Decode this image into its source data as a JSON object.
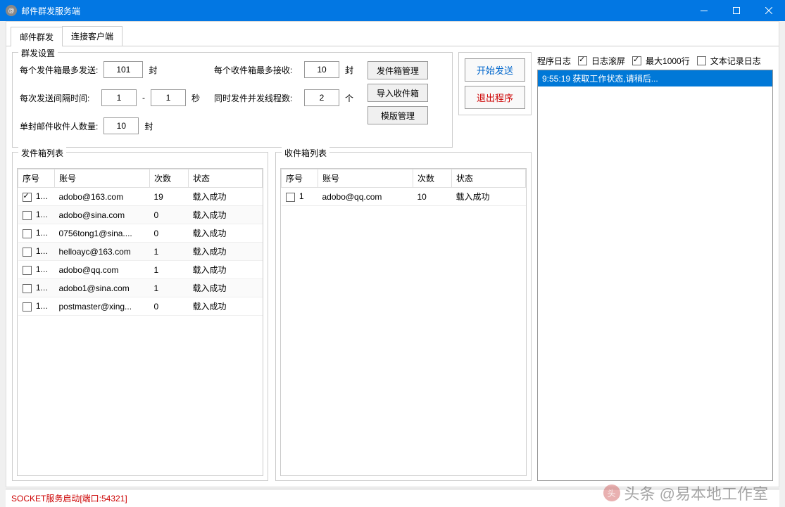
{
  "window": {
    "title": "邮件群发服务端"
  },
  "tabs": {
    "mass_mail": "邮件群发",
    "connect_client": "连接客户端"
  },
  "settings": {
    "legend": "群发设置",
    "max_send_per_sender_label": "每个发件箱最多发送:",
    "max_send_per_sender_value": "101",
    "max_send_unit": "封",
    "interval_label": "每次发送间隔时间:",
    "interval_from": "1",
    "interval_to": "1",
    "interval_sep": "-",
    "interval_unit": "秒",
    "recipients_per_mail_label": "单封邮件收件人数量:",
    "recipients_per_mail_value": "10",
    "recipients_per_mail_unit": "封",
    "max_recv_per_recipient_label": "每个收件箱最多接收:",
    "max_recv_per_recipient_value": "10",
    "max_recv_unit": "封",
    "concurrent_threads_label": "同时发件并发线程数:",
    "concurrent_threads_value": "2",
    "concurrent_unit": "个",
    "btn_sender_mgmt": "发件箱管理",
    "btn_import_recipient": "导入收件箱",
    "btn_template_mgmt": "模版管理"
  },
  "actions": {
    "start_send": "开始发送",
    "exit_program": "退出程序"
  },
  "sender_table": {
    "legend": "发件箱列表",
    "col_seq": "序号",
    "col_account": "账号",
    "col_count": "次数",
    "col_status": "状态",
    "rows": [
      {
        "checked": true,
        "seq": "11...",
        "account": "adobo@163.com",
        "count": "19",
        "status": "载入成功"
      },
      {
        "checked": false,
        "seq": "11...",
        "account": "adobo@sina.com",
        "count": "0",
        "status": "载入成功"
      },
      {
        "checked": false,
        "seq": "11...",
        "account": "0756tong1@sina....",
        "count": "0",
        "status": "载入成功"
      },
      {
        "checked": false,
        "seq": "11...",
        "account": "helloayc@163.com",
        "count": "1",
        "status": "载入成功"
      },
      {
        "checked": false,
        "seq": "11...",
        "account": "adobo@qq.com",
        "count": "1",
        "status": "载入成功"
      },
      {
        "checked": false,
        "seq": "11...",
        "account": "adobo1@sina.com",
        "count": "1",
        "status": "载入成功"
      },
      {
        "checked": false,
        "seq": "11...",
        "account": "postmaster@xing...",
        "count": "0",
        "status": "载入成功"
      }
    ]
  },
  "recipient_table": {
    "legend": "收件箱列表",
    "col_seq": "序号",
    "col_account": "账号",
    "col_count": "次数",
    "col_status": "状态",
    "rows": [
      {
        "checked": false,
        "seq": "1",
        "account": "adobo@qq.com",
        "count": "10",
        "status": "载入成功"
      }
    ]
  },
  "log": {
    "title": "程序日志",
    "chk_scroll": "日志滚屏",
    "chk_scroll_checked": true,
    "chk_max1000": "最大1000行",
    "chk_max1000_checked": true,
    "chk_textlog": "文本记录日志",
    "chk_textlog_checked": false,
    "entries": [
      {
        "time": "9:55:19",
        "text": "获取工作状态,请稍后..."
      }
    ]
  },
  "status_bar": "SOCKET服务启动[端口:54321]",
  "watermark": "头条 @易本地工作室"
}
